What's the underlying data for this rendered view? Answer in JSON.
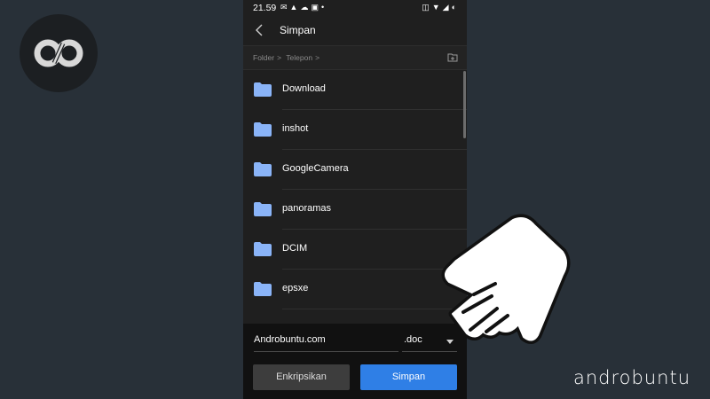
{
  "status_bar": {
    "time": "21.59"
  },
  "app_bar": {
    "title": "Simpan",
    "back_icon": "arrow-left-icon"
  },
  "breadcrumb": {
    "items": [
      "Folder",
      "Telepon"
    ],
    "separator": ">",
    "new_folder_icon": "new-folder-icon"
  },
  "folders": [
    {
      "name": "Download"
    },
    {
      "name": "inshot"
    },
    {
      "name": "GoogleCamera"
    },
    {
      "name": "panoramas"
    },
    {
      "name": "DCIM"
    },
    {
      "name": "epsxe"
    }
  ],
  "save_form": {
    "filename": "Androbuntu.com",
    "extension": ".doc"
  },
  "buttons": {
    "encrypt_label": "Enkripsikan",
    "save_label": "Simpan"
  },
  "watermark": {
    "text": "androbuntu"
  },
  "colors": {
    "background": "#283038",
    "phone_background": "#1f1f1f",
    "folder_icon": "#8ab4f8",
    "save_button": "#2f7fe6",
    "encrypt_button": "#3d3d3d"
  }
}
